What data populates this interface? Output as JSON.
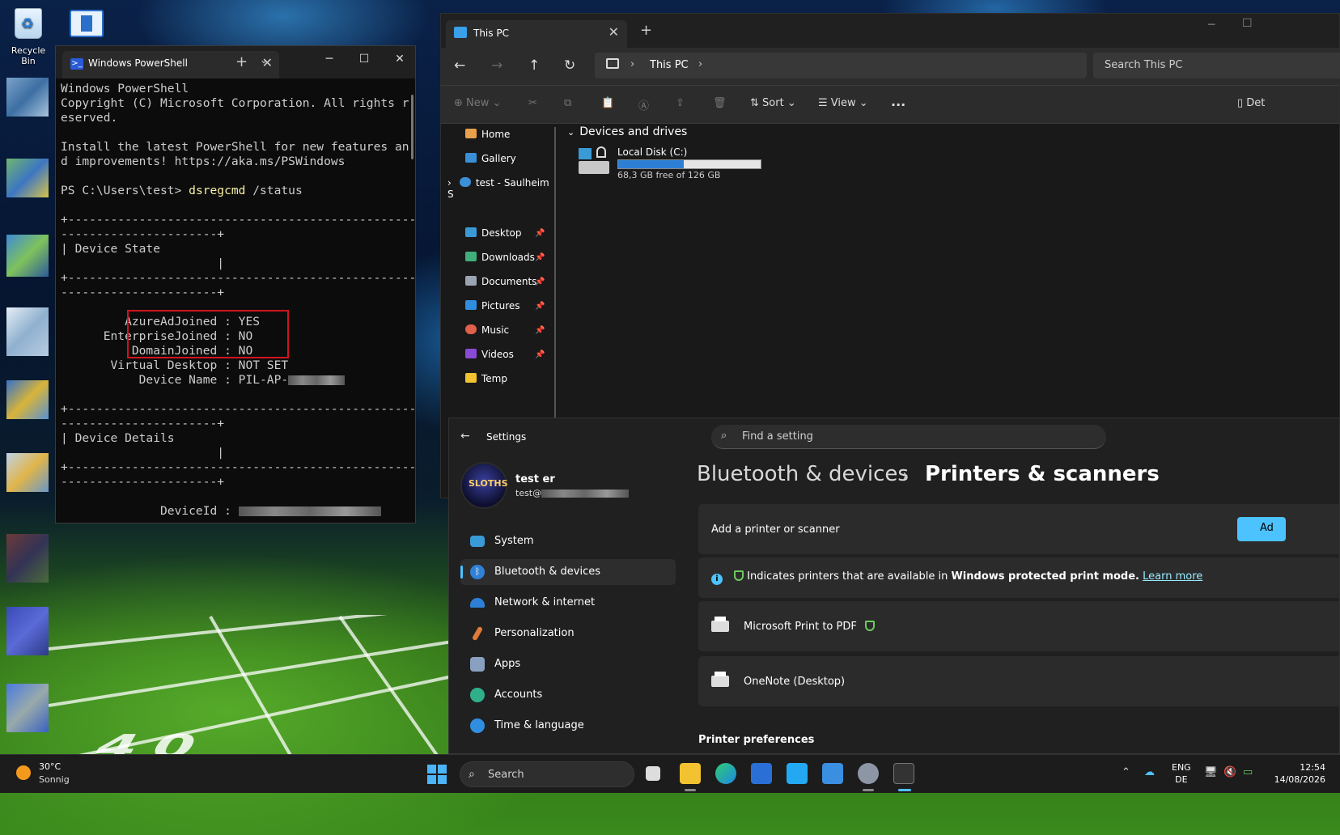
{
  "desktop": {
    "recycle_bin_label": "Recycle Bin"
  },
  "powershell": {
    "tab_title": "Windows PowerShell",
    "lines": {
      "l1": "Windows PowerShell",
      "l2": "Copyright (C) Microsoft Corporation. All rights r",
      "l3": "eserved.",
      "l4": "Install the latest PowerShell for new features an",
      "l5": "d improvements! https://aka.ms/PSWindows",
      "prompt": "PS C:\\Users\\test> ",
      "command": "dsregcmd",
      "command_args": " /status",
      "sep1": "+-------------------------------------------------",
      "sep2": "----------------------+",
      "section1": "| Device State",
      "pipe": "                      |",
      "azure": "         AzureAdJoined : YES",
      "enterprise": "      EnterpriseJoined : NO",
      "domain": "          DomainJoined : NO",
      "virtual": "       Virtual Desktop : NOT SET",
      "devname": "           Device Name : PIL-AP-",
      "section2": "| Device Details",
      "deviceid": "              DeviceId : "
    }
  },
  "explorer": {
    "tab_title": "This PC",
    "address": "This PC",
    "search_placeholder": "Search This PC",
    "toolbar": {
      "new": "New",
      "sort": "Sort",
      "view": "View",
      "more": "...",
      "details": "Det"
    },
    "nav": {
      "home": "Home",
      "gallery": "Gallery",
      "onedrive": "test - Saulheim S",
      "desktop": "Desktop",
      "downloads": "Downloads",
      "documents": "Documents",
      "pictures": "Pictures",
      "music": "Music",
      "videos": "Videos",
      "temp": "Temp"
    },
    "section_title": "Devices and drives",
    "drive": {
      "name": "Local Disk (C:)",
      "free_text": "68,3 GB free of 126 GB",
      "used_fraction": 0.46
    }
  },
  "settings": {
    "app_title": "Settings",
    "search_placeholder": "Find a setting",
    "user": {
      "name": "test er",
      "email_prefix": "test@",
      "avatar_text": "SLOTHS"
    },
    "nav": {
      "system": "System",
      "bluetooth": "Bluetooth & devices",
      "network": "Network & internet",
      "personalization": "Personalization",
      "apps": "Apps",
      "accounts": "Accounts",
      "time": "Time & language"
    },
    "breadcrumb_parent": "Bluetooth & devices",
    "breadcrumb_current": "Printers & scanners",
    "add_printer": {
      "label": "Add a printer or scanner",
      "button": "Ad"
    },
    "info": {
      "text_pre": "Indicates printers that are available in ",
      "text_bold": "Windows protected print mode.",
      "link": "Learn more"
    },
    "printers": {
      "p1": "Microsoft Print to PDF",
      "p2": "OneNote (Desktop)"
    },
    "preferences_heading": "Printer preferences"
  },
  "taskbar": {
    "weather_temp": "30°C",
    "weather_condition": "Sonnig",
    "search_label": "Search",
    "lang_top": "ENG",
    "lang_bottom": "DE",
    "time": "12:54",
    "date": "14/08/2026"
  }
}
